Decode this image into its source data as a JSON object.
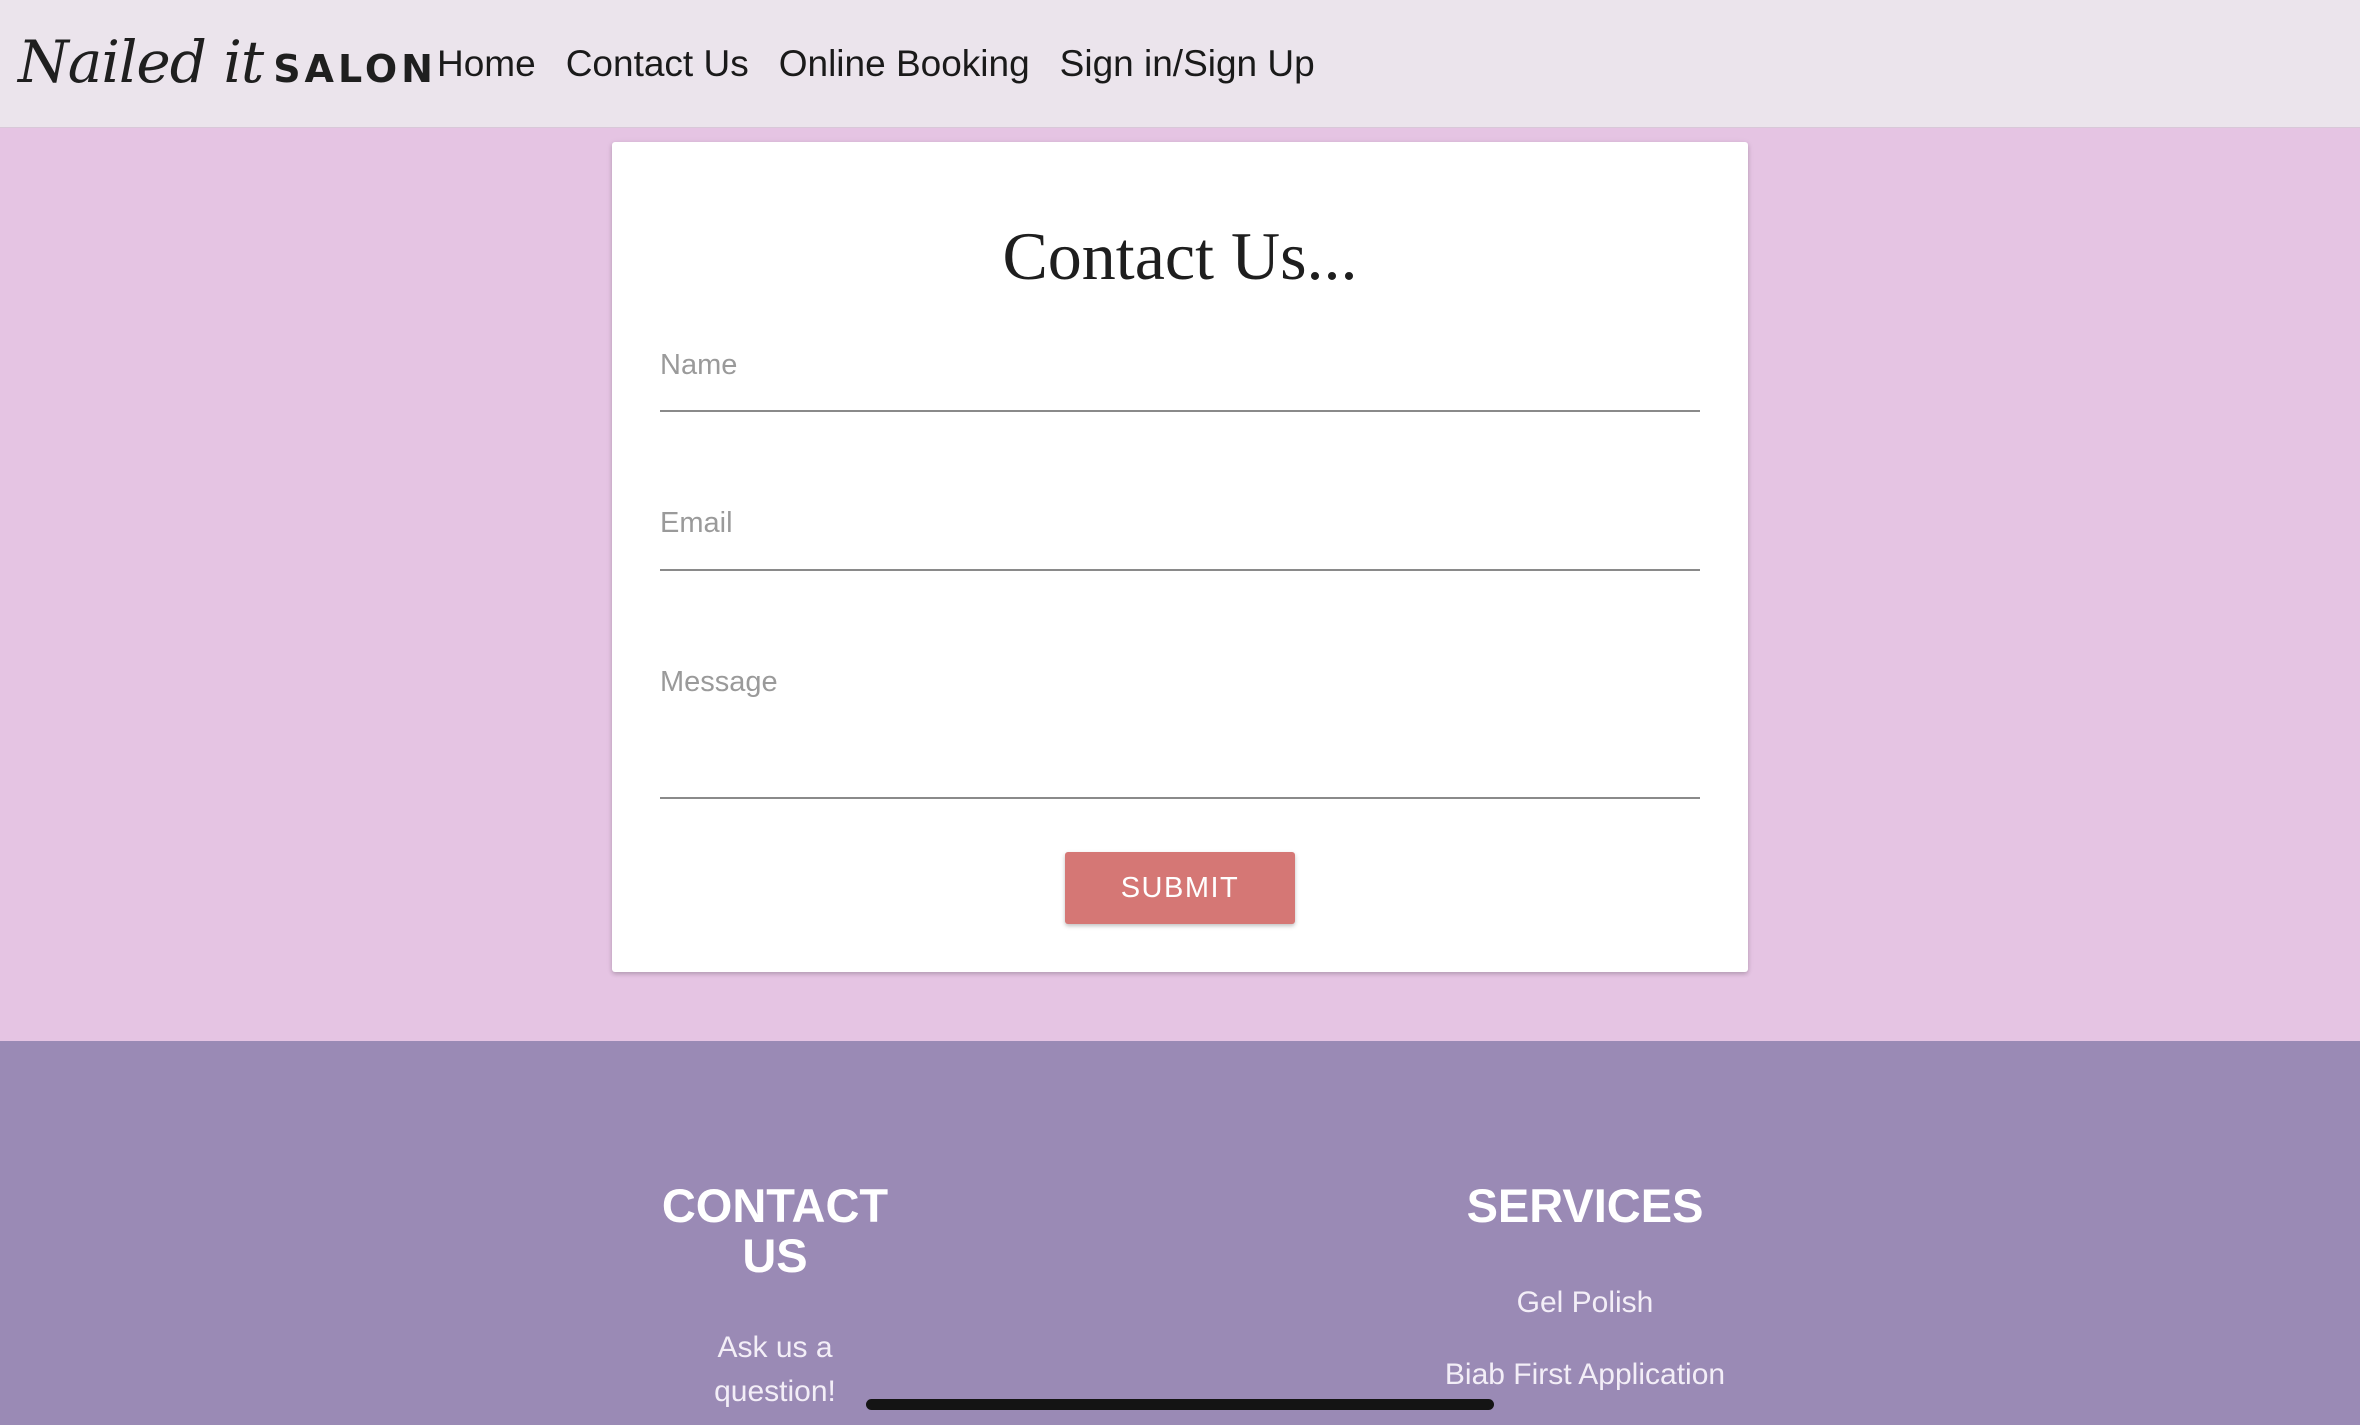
{
  "brand": {
    "script": "Nailed it",
    "word": "SALON"
  },
  "nav": {
    "items": [
      {
        "label": "Home"
      },
      {
        "label": "Contact Us"
      },
      {
        "label": "Online Booking"
      },
      {
        "label": "Sign in/Sign Up"
      }
    ]
  },
  "contact_form": {
    "title": "Contact Us...",
    "name_placeholder": "Name",
    "email_placeholder": "Email",
    "message_placeholder": "Message",
    "submit_label": "SUBMIT"
  },
  "footer": {
    "contact": {
      "heading": "CONTACT US",
      "text": "Ask us a question!"
    },
    "services": {
      "heading": "SERVICES",
      "items": [
        {
          "label": "Gel Polish"
        },
        {
          "label": "Biab First Application"
        }
      ]
    }
  },
  "colors": {
    "page_background": "#e5c4e3",
    "navbar_background": "#ebe4ec",
    "footer_background": "#9a8ab5",
    "submit_button": "#d57775"
  }
}
